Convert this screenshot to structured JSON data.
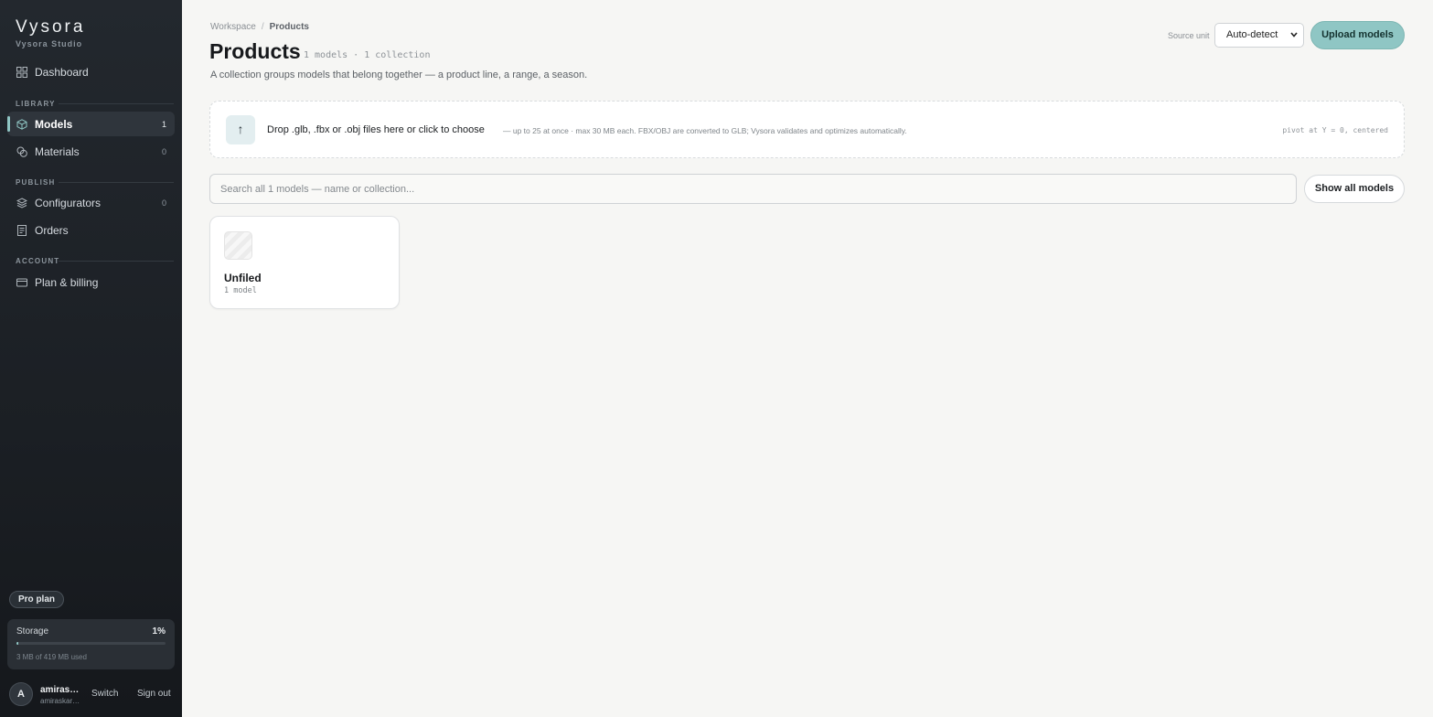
{
  "brand": {
    "name": "Vysora",
    "subtitle": "Vysora Studio"
  },
  "sidebar": {
    "items": [
      {
        "label": "Dashboard",
        "count": "",
        "icon": "grid-icon"
      },
      {
        "label": "Models",
        "count": "1",
        "icon": "cube-icon",
        "active": true
      },
      {
        "label": "Materials",
        "count": "0",
        "icon": "materials-icon"
      },
      {
        "label": "Configurators",
        "count": "0",
        "icon": "layers-icon"
      },
      {
        "label": "Orders",
        "count": "",
        "icon": "receipt-icon"
      },
      {
        "label": "Plan & billing",
        "count": "",
        "icon": "card-icon"
      }
    ],
    "sections": {
      "library": "LIBRARY",
      "publish": "PUBLISH",
      "account": "ACCOUNT"
    },
    "plan_badge": "Pro plan",
    "storage": {
      "label": "Storage",
      "percent": "1%",
      "used_fraction": 0.01,
      "used_text": "3 MB of 419 MB used"
    },
    "user": {
      "initial": "A",
      "name": "amiraskarova",
      "email": "amiraskarova@",
      "switch_label": "Switch",
      "signout_label": "Sign out"
    }
  },
  "breadcrumb": {
    "root": "Workspace",
    "separator": "/",
    "current": "Products"
  },
  "header": {
    "title": "Products",
    "meta": "1 models · 1 collection",
    "description": "A collection groups models that belong together — a product line, a range, a season.",
    "source_unit_label": "Source unit",
    "source_unit_value": "Auto-detect",
    "upload_label": "Upload models"
  },
  "dropzone": {
    "icon": "↑",
    "main": "Drop .glb, .fbx or .obj files here or click to choose",
    "sub": "— up to 25 at once · max 30 MB each. FBX/OBJ are converted to GLB; Vysora validates and optimizes automatically.",
    "pivot": "pivot at Y = 0, centered"
  },
  "search": {
    "placeholder": "Search all 1 models — name or collection...",
    "show_all_label": "Show all models"
  },
  "collections": [
    {
      "title": "Unfiled",
      "count": "1 model"
    }
  ],
  "colors": {
    "accent": "#8fc6c4",
    "sidebar_bg": "#1f2328",
    "page_bg": "#f6f6f4"
  }
}
